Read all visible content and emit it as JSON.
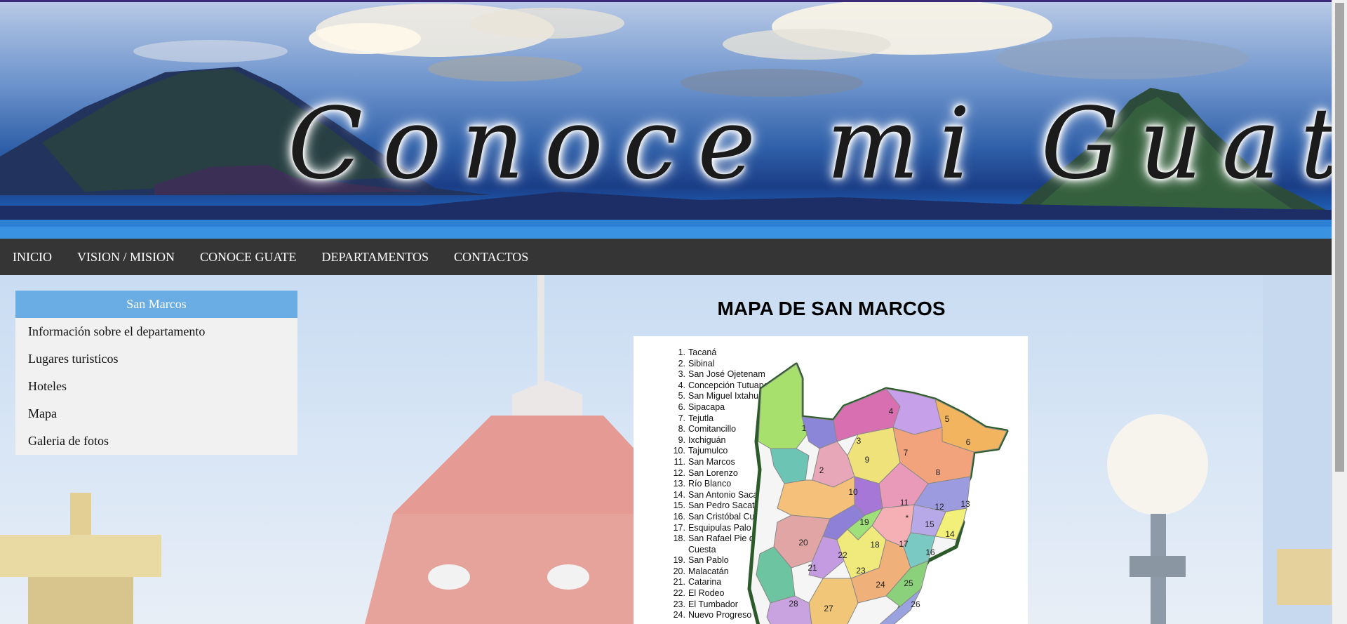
{
  "header": {
    "title": "Conoce mi Guate"
  },
  "nav": {
    "items": [
      "INICIO",
      "VISION / MISION",
      "CONOCE GUATE",
      "DEPARTAMENTOS",
      "CONTACTOS"
    ]
  },
  "sidebar": {
    "title": "San Marcos",
    "items": [
      "Información sobre el departamento",
      "Lugares turisticos",
      "Hoteles",
      "Mapa",
      "Galeria de fotos"
    ]
  },
  "main": {
    "title": "MAPA DE SAN MARCOS",
    "map_legend": [
      {
        "num": "1.",
        "name": "Tacaná"
      },
      {
        "num": "2.",
        "name": "Sibinal"
      },
      {
        "num": "3.",
        "name": "San José Ojetenam"
      },
      {
        "num": "4.",
        "name": "Concepción Tutuapa"
      },
      {
        "num": "5.",
        "name": "San Miguel Ixtahuacán"
      },
      {
        "num": "6.",
        "name": "Sipacapa"
      },
      {
        "num": "7.",
        "name": "Tejutla"
      },
      {
        "num": "8.",
        "name": "Comitancillo"
      },
      {
        "num": "9.",
        "name": "Ixchiguán"
      },
      {
        "num": "10.",
        "name": "Tajumulco"
      },
      {
        "num": "11.",
        "name": "San Marcos"
      },
      {
        "num": "12.",
        "name": "San Lorenzo"
      },
      {
        "num": "13.",
        "name": "Río Blanco"
      },
      {
        "num": "14.",
        "name": "San Antonio Sacatepéquez"
      },
      {
        "num": "15.",
        "name": "San Pedro Sacatepéquez"
      },
      {
        "num": "16.",
        "name": "San Cristóbal Cucho"
      },
      {
        "num": "17.",
        "name": "Esquipulas Palo Gordo"
      },
      {
        "num": "18.",
        "name": "San Rafael Pie de la"
      },
      {
        "num": "",
        "name": "Cuesta"
      },
      {
        "num": "19.",
        "name": "San Pablo"
      },
      {
        "num": "20.",
        "name": "Malacatán"
      },
      {
        "num": "21.",
        "name": "Catarina"
      },
      {
        "num": "22.",
        "name": "El Rodeo"
      },
      {
        "num": "23.",
        "name": "El Tumbador"
      },
      {
        "num": "24.",
        "name": "Nuevo Progreso"
      }
    ],
    "map_region_numbers": [
      "1",
      "2",
      "3",
      "4",
      "5",
      "6",
      "7",
      "8",
      "9",
      "10",
      "11",
      "12",
      "13",
      "14",
      "15",
      "16",
      "17",
      "18",
      "19",
      "20",
      "21",
      "22",
      "23",
      "24",
      "25",
      "26",
      "27",
      "28",
      "*"
    ]
  },
  "colors": {
    "nav_bg": "#353535",
    "sidebar_header_bg": "#6aace4",
    "sidebar_bg": "#f1f1f1"
  }
}
